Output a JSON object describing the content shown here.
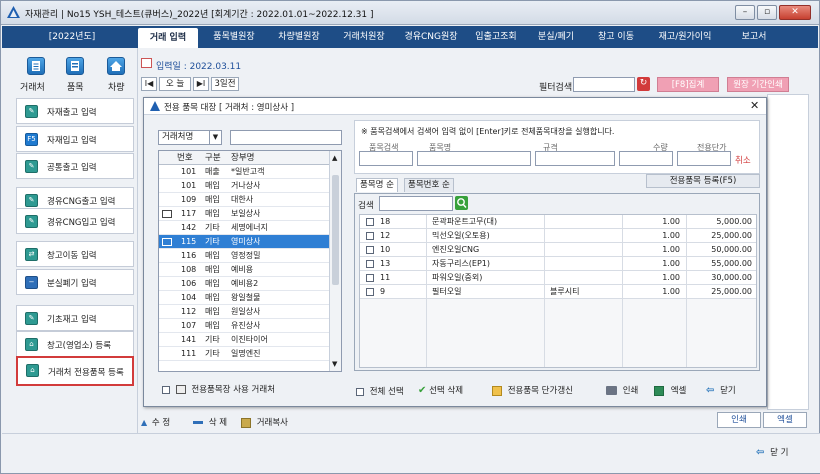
{
  "window": {
    "title": "자재관리 | No15 YSH_테스트(큐버스)_2022년 [회계기간 : 2022.01.01~2022.12.31 ]",
    "buttons": [
      "–",
      "▫",
      "✕"
    ]
  },
  "menubar": {
    "year": "[2022년도]",
    "items": [
      "거래 입력",
      "품목별원장",
      "차량별원장",
      "거래처원장",
      "경유CNG원장",
      "입출고조회",
      "분실/폐기",
      "창고 이동",
      "재고/원가이익",
      "보고서"
    ],
    "active_index": 0
  },
  "top_icons": [
    {
      "label": "거래처",
      "icon": "document-icon"
    },
    {
      "label": "품목",
      "icon": "list-icon"
    },
    {
      "label": "차량",
      "icon": "home-icon"
    }
  ],
  "sidebar": {
    "items": [
      {
        "label": "자재출고 입력",
        "icon": "pencil-icon",
        "mark": "✎"
      },
      {
        "label": "자재입고 입력",
        "icon": "f5-icon",
        "mark": "F5"
      },
      {
        "label": "공통출고 입력",
        "icon": "pencil-icon",
        "mark": "✎"
      },
      {
        "label": "경유CNG출고 입력",
        "icon": "pencil-icon",
        "mark": "✎"
      },
      {
        "label": "경유CNG입고 입력",
        "icon": "pencil-icon",
        "mark": "✎"
      },
      {
        "label": "창고이동 입력",
        "icon": "transfer-icon",
        "mark": "⇄"
      },
      {
        "label": "분실폐기 입력",
        "icon": "minus-icon",
        "mark": "−"
      },
      {
        "label": "기초재고 입력",
        "icon": "edit-icon",
        "mark": "✎"
      },
      {
        "label": "창고(영업소) 등록",
        "icon": "warehouse-icon",
        "mark": "⌂"
      },
      {
        "label": "거래처 전용품목 등록",
        "icon": "warehouse-icon",
        "mark": "⌂"
      }
    ],
    "selected_index": 9
  },
  "background": {
    "date_label": "입력일 : 2022.03.11",
    "nav": {
      "first": "I◀",
      "today": "오 늘",
      "last": "▶I",
      "period": "3일전"
    },
    "filter_label": "필터검색",
    "filter_value": "",
    "f8_label": "[F8]집계",
    "ledger_print_label": "원장 기간인쇄",
    "bottom_buttons": [
      "수 정",
      "삭 제",
      "거래복사"
    ],
    "print_label": "인쇄",
    "excel_label": "엑셀",
    "close_label": "닫 기"
  },
  "dialog": {
    "title": "전용 품목 대장 [ 거래처 : 영미상사 ]",
    "close": "✕",
    "search_field": "거래처명",
    "search_value": "",
    "left_headers": [
      "번호",
      "구분",
      "장부명"
    ],
    "left_rows": [
      {
        "icon": "",
        "no": "101",
        "type": "매출",
        "name": "*일반고객"
      },
      {
        "icon": "",
        "no": "101",
        "type": "매입",
        "name": "거나상사"
      },
      {
        "icon": "",
        "no": "109",
        "type": "매입",
        "name": "대한사"
      },
      {
        "icon": "book",
        "no": "117",
        "type": "매입",
        "name": "보일상사"
      },
      {
        "icon": "",
        "no": "142",
        "type": "기타",
        "name": "세명에너지"
      },
      {
        "icon": "book",
        "no": "115",
        "type": "기타",
        "name": "영미상사"
      },
      {
        "icon": "",
        "no": "116",
        "type": "매입",
        "name": "영정정밀"
      },
      {
        "icon": "",
        "no": "108",
        "type": "매입",
        "name": "예비용"
      },
      {
        "icon": "",
        "no": "106",
        "type": "매입",
        "name": "예비용2"
      },
      {
        "icon": "",
        "no": "104",
        "type": "매입",
        "name": "왕일철물"
      },
      {
        "icon": "",
        "no": "112",
        "type": "매입",
        "name": "원일상사"
      },
      {
        "icon": "",
        "no": "107",
        "type": "매입",
        "name": "유진상사"
      },
      {
        "icon": "",
        "no": "141",
        "type": "기타",
        "name": "이진타이어"
      },
      {
        "icon": "",
        "no": "111",
        "type": "기타",
        "name": "일명엔진"
      }
    ],
    "left_selected_index": 5,
    "use_only_label": "전용품목장 사용 거래처",
    "notice": "※ 품목검색에서 검색어 입력 없이 [Enter]키로 전체품목대장을 실행합니다.",
    "input_headers": [
      "품목검색",
      "품목명",
      "규격",
      "수량",
      "전용단가"
    ],
    "cancel_label": "취소",
    "tabs": [
      "품목명 순",
      "품목번호 순"
    ],
    "register_label": "전용품목 등록(F5)",
    "search_label": "검색",
    "search_input": "",
    "right_rows": [
      {
        "no": "18",
        "name": "문곽파운트고무(대)",
        "spec": "",
        "qty": "1.00",
        "price": "5,000.00"
      },
      {
        "no": "12",
        "name": "믹선오일(오토용)",
        "spec": "",
        "qty": "1.00",
        "price": "25,000.00"
      },
      {
        "no": "10",
        "name": "엔진오일CNG",
        "spec": "",
        "qty": "1.00",
        "price": "50,000.00"
      },
      {
        "no": "13",
        "name": "자동구리스(EP1)",
        "spec": "",
        "qty": "1.00",
        "price": "55,000.00"
      },
      {
        "no": "11",
        "name": "파워오일(중외)",
        "spec": "",
        "qty": "1.00",
        "price": "30,000.00"
      },
      {
        "no": "9",
        "name": "필터오일",
        "spec": "블루시티",
        "qty": "1.00",
        "price": "25,000.00"
      }
    ],
    "footer": {
      "select_all": "전체 선택",
      "delete_selected": "선택 삭제",
      "update_price": "전용품목 단가갱신",
      "print": "인쇄",
      "excel": "엑셀",
      "close": "닫기"
    }
  },
  "colors": {
    "menubar": "#1e4d86",
    "selected_row": "#2f7fd4",
    "accent_red": "#d23b3b",
    "pink_button": "#f0a0b4"
  }
}
